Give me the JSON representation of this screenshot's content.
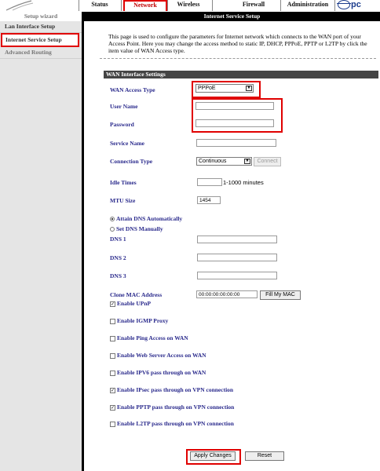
{
  "nav": {
    "tabs": [
      {
        "label": "Status"
      },
      {
        "label": "Network"
      },
      {
        "label": "Wireless"
      },
      {
        "label": "Firewall"
      },
      {
        "label": "Administration"
      }
    ],
    "brand": "pc"
  },
  "sidebar": {
    "header": "Setup wizard",
    "items": [
      {
        "label": "Lan Interface Setup"
      },
      {
        "label": "Internet Service Setup"
      },
      {
        "label": "Advanced Routing"
      }
    ]
  },
  "main": {
    "title": "Internet Service Setup",
    "intro": "This page is used to configure the parameters for Internet network which connects to the WAN port of your Access Point. Here you may change the access method to static IP, DHCP, PPPoE, PPTP or L2TP by click the item value of WAN Access type.",
    "section_title": "WAN Interface Settings",
    "wan_access_type": {
      "label": "WAN Access Type",
      "value": "PPPoE"
    },
    "user_name": {
      "label": "User Name",
      "value": ""
    },
    "password": {
      "label": "Password",
      "value": ""
    },
    "service_name": {
      "label": "Service Name",
      "value": ""
    },
    "connection_type": {
      "label": "Connection Type",
      "value": "Continuous",
      "connect_label": "Connect"
    },
    "idle_time": {
      "label": "Idle Times",
      "value": "",
      "hint": "1-1000 minutes"
    },
    "mtu": {
      "label": "MTU Size",
      "value": "1454"
    },
    "dns_auto": {
      "label": "Attain DNS Automatically",
      "checked": true
    },
    "dns_manual": {
      "label": "Set DNS Manually",
      "checked": false
    },
    "dns1": {
      "label": "DNS 1",
      "value": ""
    },
    "dns2": {
      "label": "DNS 2",
      "value": ""
    },
    "dns3": {
      "label": "DNS 3",
      "value": ""
    },
    "clone_mac": {
      "label": "Clone MAC Address",
      "value": "00:00:00:00:00:00",
      "button": "Fill My MAC"
    },
    "checkboxes": [
      {
        "label": "Enable UPnP",
        "checked": true
      },
      {
        "label": "Enable IGMP Proxy",
        "checked": false
      },
      {
        "label": "Enable Ping Access on WAN",
        "checked": false
      },
      {
        "label": "Enable Web Server Access on WAN",
        "checked": false
      },
      {
        "label": "Enable IPV6 pass through on WAN",
        "checked": false
      },
      {
        "label": "Enable IPsec pass through on VPN connection",
        "checked": true
      },
      {
        "label": "Enable PPTP pass through on VPN connection",
        "checked": true
      },
      {
        "label": "Enable L2TP pass through on VPN connection",
        "checked": false
      }
    ],
    "apply_label": "Apply Changes",
    "reset_label": "Reset"
  }
}
